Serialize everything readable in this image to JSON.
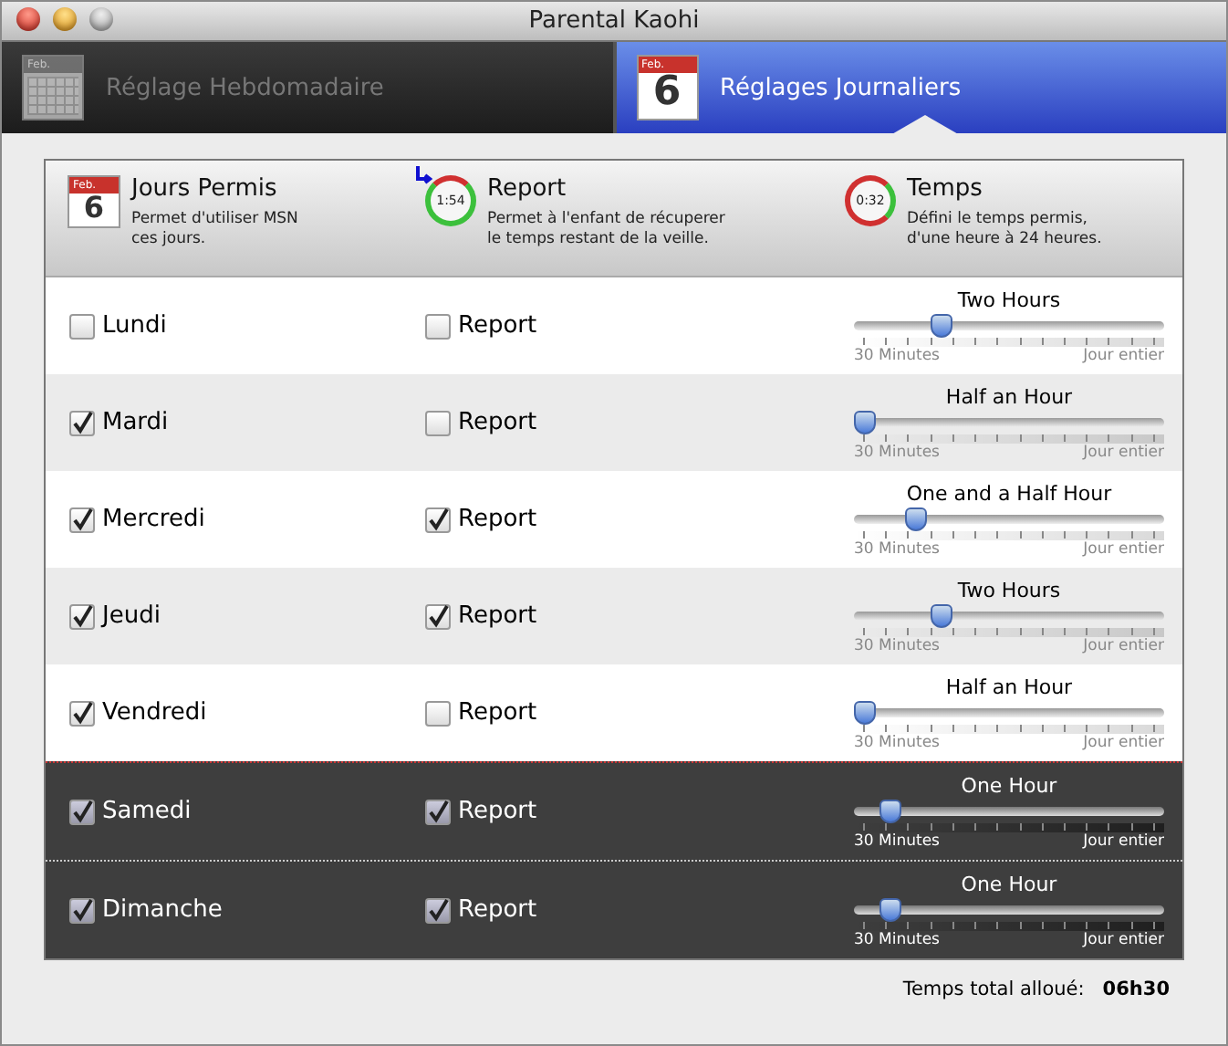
{
  "window": {
    "title": "Parental Kaohi"
  },
  "tabs": [
    {
      "label": "Réglage Hebdomadaire",
      "selected": false,
      "icon_month": "Feb."
    },
    {
      "label": "Réglages Journaliers",
      "selected": true,
      "icon_month": "Feb.",
      "icon_day": "6"
    }
  ],
  "header": [
    {
      "kind": "calendar",
      "title": "Jours Permis",
      "description": "Permet d'utiliser MSN\nces jours.",
      "icon_month": "Feb.",
      "icon_day": "6"
    },
    {
      "kind": "report",
      "title": "Report",
      "description": "Permet à l'enfant de récuperer\nle temps restant de la veille.",
      "icon_time": "1:54"
    },
    {
      "kind": "time",
      "title": "Temps",
      "description": "Défini le temps permis,\nd'une heure à 24 heures.",
      "icon_time": "0:32"
    }
  ],
  "rows": [
    {
      "kind": "weekday",
      "day": "Lundi",
      "allowed": false,
      "report_label": "Report",
      "report": false,
      "time_label": "Two Hours",
      "level": 0.27,
      "min_label": "30 Minutes",
      "max_label": "Jour entier"
    },
    {
      "kind": "weekday",
      "day": "Mardi",
      "allowed": true,
      "report_label": "Report",
      "report": false,
      "time_label": "Half an Hour",
      "level": 0,
      "min_label": "30 Minutes",
      "max_label": "Jour entier"
    },
    {
      "kind": "weekday",
      "day": "Mercredi",
      "allowed": true,
      "report_label": "Report",
      "report": true,
      "time_label": "One and a Half Hour",
      "level": 0.18,
      "min_label": "30 Minutes",
      "max_label": "Jour entier"
    },
    {
      "kind": "weekday",
      "day": "Jeudi",
      "allowed": true,
      "report_label": "Report",
      "report": true,
      "time_label": "Two Hours",
      "level": 0.27,
      "min_label": "30 Minutes",
      "max_label": "Jour entier"
    },
    {
      "kind": "weekday",
      "day": "Vendredi",
      "allowed": true,
      "report_label": "Report",
      "report": false,
      "time_label": "Half an Hour",
      "level": 0,
      "min_label": "30 Minutes",
      "max_label": "Jour entier"
    },
    {
      "kind": "weekend",
      "day": "Samedi",
      "allowed": true,
      "report_label": "Report",
      "report": true,
      "time_label": "One Hour",
      "level": 0.09,
      "min_label": "30 Minutes",
      "max_label": "Jour entier"
    },
    {
      "kind": "weekend",
      "day": "Dimanche",
      "allowed": true,
      "report_label": "Report",
      "report": true,
      "time_label": "One Hour",
      "level": 0.09,
      "min_label": "30 Minutes",
      "max_label": "Jour entier"
    }
  ],
  "total": {
    "label": "Temps total alloué:",
    "value": "06h30"
  }
}
